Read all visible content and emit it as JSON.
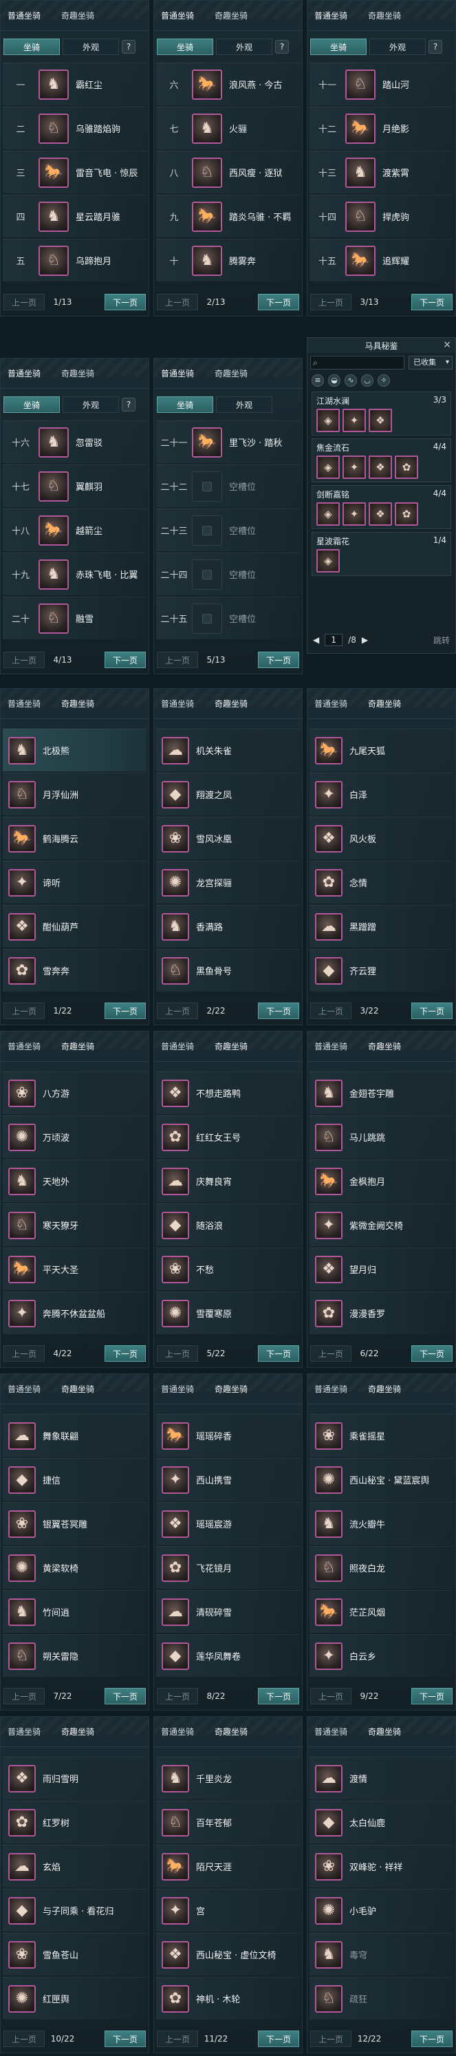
{
  "tabs": {
    "normal": "普通坐骑",
    "fun": "奇趣坐骑",
    "mount": "坐骑",
    "look": "外观",
    "help": "?"
  },
  "pager": {
    "prev": "上一页",
    "next": "下一页"
  },
  "icons": {
    "mount": "horse-icon",
    "empty": "empty-slot-icon"
  },
  "slotpanels": [
    {
      "page": "1/13",
      "rows": [
        [
          "一",
          "霸红尘"
        ],
        [
          "二",
          "乌骓踏焰驹"
        ],
        [
          "三",
          "雷音飞电 · 惊辰"
        ],
        [
          "四",
          "星云踏月骓"
        ],
        [
          "五",
          "乌蹄抱月"
        ]
      ]
    },
    {
      "page": "2/13",
      "rows": [
        [
          "六",
          "浪风燕 · 今古"
        ],
        [
          "七",
          "火骊"
        ],
        [
          "八",
          "西风瘦 · 逐狱"
        ],
        [
          "九",
          "踏炎乌骓 · 不羁"
        ],
        [
          "十",
          "腾雾奔"
        ]
      ]
    },
    {
      "page": "3/13",
      "rows": [
        [
          "十一",
          "踏山河"
        ],
        [
          "十二",
          "月绝影"
        ],
        [
          "十三",
          "渡紫霄"
        ],
        [
          "十四",
          "捍虎驹"
        ],
        [
          "十五",
          "追辉耀"
        ]
      ]
    },
    {
      "page": "4/13",
      "rows": [
        [
          "十六",
          "忽雷驳"
        ],
        [
          "十七",
          "翼麒羽"
        ],
        [
          "十八",
          "越箭尘"
        ],
        [
          "十九",
          "赤珠飞电 · 比翼"
        ],
        [
          "二十",
          "融雪"
        ]
      ]
    },
    {
      "page": "5/13",
      "rows": [
        [
          "二十一",
          "里飞沙 · 踏秋"
        ],
        [
          "二十二",
          "空槽位"
        ],
        [
          "二十三",
          "空槽位"
        ],
        [
          "二十四",
          "空槽位"
        ],
        [
          "二十五",
          "空槽位"
        ]
      ]
    }
  ],
  "mahei": {
    "title": "马具秘鉴",
    "close": "×",
    "filter": "已收集",
    "page": "1",
    "total": "/8",
    "jump": "跳转",
    "sets": [
      {
        "name": "江湖水澜",
        "count": "3/3",
        "n": 3
      },
      {
        "name": "焦金流石",
        "count": "4/4",
        "n": 4
      },
      {
        "name": "剑断嘉铭",
        "count": "4/4",
        "n": 4
      },
      {
        "name": "星波霜花",
        "count": "1/4",
        "n": 1
      }
    ]
  },
  "funpanels": [
    {
      "page": "1/22",
      "rows": [
        "北极熊",
        "月浮仙洲",
        "鹤海腾云",
        "谛听",
        "酣仙葫芦",
        "雪奔奔"
      ]
    },
    {
      "page": "2/22",
      "rows": [
        "机关朱雀",
        "翔渡之凤",
        "雪风冰凰",
        "龙宫探骊",
        "香满路",
        "黑鱼骨号"
      ]
    },
    {
      "page": "3/22",
      "rows": [
        "九尾天狐",
        "白泽",
        "风火板",
        "念情",
        "黑蹭蹭",
        "齐云狸"
      ]
    },
    {
      "page": "4/22",
      "rows": [
        "八方游",
        "万顷波",
        "天地外",
        "寒天獠牙",
        "平天大圣",
        "奔腾不休盆盆船"
      ]
    },
    {
      "page": "5/22",
      "rows": [
        "不想走路鸭",
        "红红女王号",
        "庆舞良宵",
        "随浴浪",
        "不愁",
        "雪覆寒原"
      ]
    },
    {
      "page": "6/22",
      "rows": [
        "金翅苍宇雕",
        "马儿跳跳",
        "金枫抱月",
        "紫微金阙交椅",
        "望月归",
        "漫漫香罗"
      ]
    },
    {
      "page": "7/22",
      "rows": [
        "舞象联翩",
        "捷信",
        "银翼苍冥雕",
        "黄梁软椅",
        "竹间逍",
        "朔关雷隐"
      ]
    },
    {
      "page": "8/22",
      "rows": [
        "瑶瑶碎香",
        "西山携雪",
        "瑶瑶宸游",
        "飞花镜月",
        "清砚碎雪",
        "莲华凤舞卷"
      ]
    },
    {
      "page": "9/22",
      "rows": [
        "乘雀摇星",
        "西山秘宝 · 黛蓝宸舆",
        "流火瓣牛",
        "照夜白龙",
        "茫芷风烟",
        "白云乡"
      ]
    },
    {
      "page": "10/22",
      "rows": [
        "雨归雪明",
        "红罗树",
        "玄焰",
        "与子同乘 · 看花归",
        "雪鱼苍山",
        "红匣舆"
      ]
    },
    {
      "page": "11/22",
      "rows": [
        "千里炎龙",
        "百年苍郁",
        "陌尺天涯",
        "宫",
        "西山秘宝 · 虚位文椅",
        "神机 · 木轮"
      ]
    },
    {
      "page": "12/22",
      "rows": [
        "渡情",
        "太白仙鹿",
        "双峰驼 · 祥祥",
        "小毛驴",
        "毒穹",
        "疏狂"
      ]
    }
  ]
}
